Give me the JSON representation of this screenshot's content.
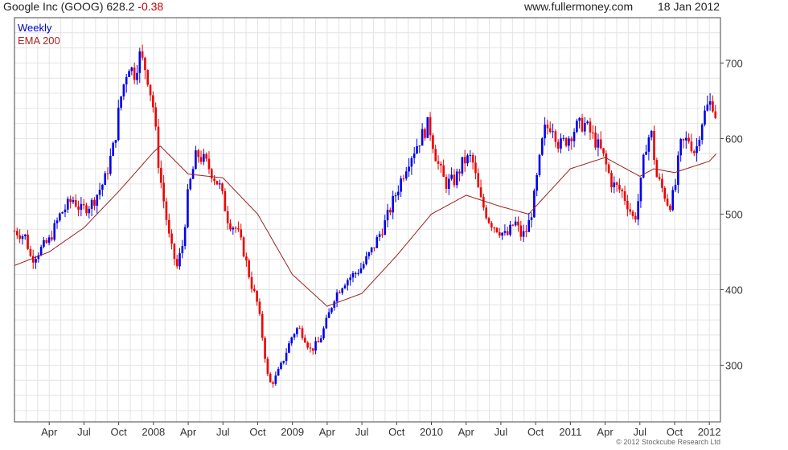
{
  "header": {
    "title": "Google Inc (GOOG) 628.2",
    "change": "-0.38",
    "site": "www.fullermoney.com",
    "date": "18 Jan 2012"
  },
  "legend": {
    "weekly": "Weekly",
    "ema": "EMA 200"
  },
  "copyright": "© 2012 Stockcube Research Ltd",
  "colors": {
    "up": "#0000ee",
    "down": "#ee0000",
    "ema": "#992222",
    "grid": "#e4e4e4",
    "axis": "#444444"
  },
  "chart_data": {
    "type": "candlestick",
    "title": "Google Inc (GOOG) 628.2 -0.38",
    "ylim": [
      225,
      760
    ],
    "yticks": [
      300,
      400,
      500,
      600,
      700
    ],
    "x_range": [
      2007.0,
      2012.08
    ],
    "xticks": [
      {
        "label": "Apr",
        "t": 2007.25
      },
      {
        "label": "Jul",
        "t": 2007.5
      },
      {
        "label": "Oct",
        "t": 2007.75
      },
      {
        "label": "2008",
        "t": 2008.0
      },
      {
        "label": "Apr",
        "t": 2008.25
      },
      {
        "label": "Jul",
        "t": 2008.5
      },
      {
        "label": "Oct",
        "t": 2008.75
      },
      {
        "label": "2009",
        "t": 2009.0
      },
      {
        "label": "Apr",
        "t": 2009.25
      },
      {
        "label": "Jul",
        "t": 2009.5
      },
      {
        "label": "Oct",
        "t": 2009.75
      },
      {
        "label": "2010",
        "t": 2010.0
      },
      {
        "label": "Apr",
        "t": 2010.25
      },
      {
        "label": "Jul",
        "t": 2010.5
      },
      {
        "label": "Oct",
        "t": 2010.75
      },
      {
        "label": "2011",
        "t": 2011.0
      },
      {
        "label": "Apr",
        "t": 2011.25
      },
      {
        "label": "Jul",
        "t": 2011.5
      },
      {
        "label": "Oct",
        "t": 2011.75
      },
      {
        "label": "2012",
        "t": 2012.0
      }
    ],
    "price_keypoints": [
      {
        "t": 2007.0,
        "v": 478
      },
      {
        "t": 2007.08,
        "v": 470
      },
      {
        "t": 2007.12,
        "v": 440
      },
      {
        "t": 2007.17,
        "v": 450
      },
      {
        "t": 2007.25,
        "v": 465
      },
      {
        "t": 2007.33,
        "v": 500
      },
      {
        "t": 2007.42,
        "v": 520
      },
      {
        "t": 2007.48,
        "v": 505
      },
      {
        "t": 2007.56,
        "v": 515
      },
      {
        "t": 2007.65,
        "v": 545
      },
      {
        "t": 2007.72,
        "v": 595
      },
      {
        "t": 2007.76,
        "v": 650
      },
      {
        "t": 2007.82,
        "v": 700
      },
      {
        "t": 2007.86,
        "v": 685
      },
      {
        "t": 2007.9,
        "v": 710
      },
      {
        "t": 2007.95,
        "v": 690
      },
      {
        "t": 2008.0,
        "v": 640
      },
      {
        "t": 2008.04,
        "v": 560
      },
      {
        "t": 2008.08,
        "v": 510
      },
      {
        "t": 2008.12,
        "v": 460
      },
      {
        "t": 2008.17,
        "v": 430
      },
      {
        "t": 2008.21,
        "v": 460
      },
      {
        "t": 2008.25,
        "v": 530
      },
      {
        "t": 2008.31,
        "v": 580
      },
      {
        "t": 2008.37,
        "v": 570
      },
      {
        "t": 2008.42,
        "v": 555
      },
      {
        "t": 2008.48,
        "v": 535
      },
      {
        "t": 2008.54,
        "v": 490
      },
      {
        "t": 2008.6,
        "v": 480
      },
      {
        "t": 2008.65,
        "v": 450
      },
      {
        "t": 2008.7,
        "v": 410
      },
      {
        "t": 2008.75,
        "v": 380
      },
      {
        "t": 2008.79,
        "v": 330
      },
      {
        "t": 2008.83,
        "v": 275
      },
      {
        "t": 2008.87,
        "v": 280
      },
      {
        "t": 2008.92,
        "v": 300
      },
      {
        "t": 2008.96,
        "v": 320
      },
      {
        "t": 2009.0,
        "v": 340
      },
      {
        "t": 2009.04,
        "v": 350
      },
      {
        "t": 2009.08,
        "v": 340
      },
      {
        "t": 2009.13,
        "v": 320
      },
      {
        "t": 2009.19,
        "v": 330
      },
      {
        "t": 2009.25,
        "v": 360
      },
      {
        "t": 2009.3,
        "v": 390
      },
      {
        "t": 2009.37,
        "v": 410
      },
      {
        "t": 2009.44,
        "v": 420
      },
      {
        "t": 2009.5,
        "v": 430
      },
      {
        "t": 2009.58,
        "v": 455
      },
      {
        "t": 2009.67,
        "v": 490
      },
      {
        "t": 2009.75,
        "v": 530
      },
      {
        "t": 2009.83,
        "v": 570
      },
      {
        "t": 2009.92,
        "v": 600
      },
      {
        "t": 2009.98,
        "v": 620
      },
      {
        "t": 2010.04,
        "v": 570
      },
      {
        "t": 2010.1,
        "v": 540
      },
      {
        "t": 2010.17,
        "v": 545
      },
      {
        "t": 2010.23,
        "v": 570
      },
      {
        "t": 2010.29,
        "v": 575
      },
      {
        "t": 2010.35,
        "v": 520
      },
      {
        "t": 2010.42,
        "v": 490
      },
      {
        "t": 2010.48,
        "v": 480
      },
      {
        "t": 2010.54,
        "v": 470
      },
      {
        "t": 2010.6,
        "v": 490
      },
      {
        "t": 2010.65,
        "v": 470
      },
      {
        "t": 2010.69,
        "v": 480
      },
      {
        "t": 2010.73,
        "v": 510
      },
      {
        "t": 2010.77,
        "v": 560
      },
      {
        "t": 2010.81,
        "v": 610
      },
      {
        "t": 2010.87,
        "v": 620
      },
      {
        "t": 2010.92,
        "v": 590
      },
      {
        "t": 2010.98,
        "v": 600
      },
      {
        "t": 2011.04,
        "v": 615
      },
      {
        "t": 2011.1,
        "v": 620
      },
      {
        "t": 2011.17,
        "v": 600
      },
      {
        "t": 2011.23,
        "v": 580
      },
      {
        "t": 2011.3,
        "v": 540
      },
      {
        "t": 2011.37,
        "v": 530
      },
      {
        "t": 2011.42,
        "v": 510
      },
      {
        "t": 2011.46,
        "v": 490
      },
      {
        "t": 2011.5,
        "v": 530
      },
      {
        "t": 2011.54,
        "v": 590
      },
      {
        "t": 2011.58,
        "v": 610
      },
      {
        "t": 2011.62,
        "v": 550
      },
      {
        "t": 2011.67,
        "v": 530
      },
      {
        "t": 2011.71,
        "v": 510
      },
      {
        "t": 2011.75,
        "v": 530
      },
      {
        "t": 2011.79,
        "v": 590
      },
      {
        "t": 2011.85,
        "v": 600
      },
      {
        "t": 2011.9,
        "v": 580
      },
      {
        "t": 2011.94,
        "v": 620
      },
      {
        "t": 2011.98,
        "v": 640
      },
      {
        "t": 2012.02,
        "v": 650
      },
      {
        "t": 2012.05,
        "v": 628
      }
    ],
    "ema_keypoints": [
      {
        "t": 2007.0,
        "v": 432
      },
      {
        "t": 2007.25,
        "v": 450
      },
      {
        "t": 2007.5,
        "v": 482
      },
      {
        "t": 2007.75,
        "v": 530
      },
      {
        "t": 2008.0,
        "v": 582
      },
      {
        "t": 2008.05,
        "v": 590
      },
      {
        "t": 2008.25,
        "v": 553
      },
      {
        "t": 2008.5,
        "v": 548
      },
      {
        "t": 2008.75,
        "v": 500
      },
      {
        "t": 2009.0,
        "v": 420
      },
      {
        "t": 2009.25,
        "v": 378
      },
      {
        "t": 2009.5,
        "v": 395
      },
      {
        "t": 2009.75,
        "v": 445
      },
      {
        "t": 2010.0,
        "v": 500
      },
      {
        "t": 2010.25,
        "v": 525
      },
      {
        "t": 2010.5,
        "v": 510
      },
      {
        "t": 2010.7,
        "v": 500
      },
      {
        "t": 2010.85,
        "v": 530
      },
      {
        "t": 2011.0,
        "v": 560
      },
      {
        "t": 2011.25,
        "v": 575
      },
      {
        "t": 2011.5,
        "v": 550
      },
      {
        "t": 2011.6,
        "v": 560
      },
      {
        "t": 2011.75,
        "v": 555
      },
      {
        "t": 2012.0,
        "v": 570
      },
      {
        "t": 2012.05,
        "v": 580
      }
    ]
  }
}
